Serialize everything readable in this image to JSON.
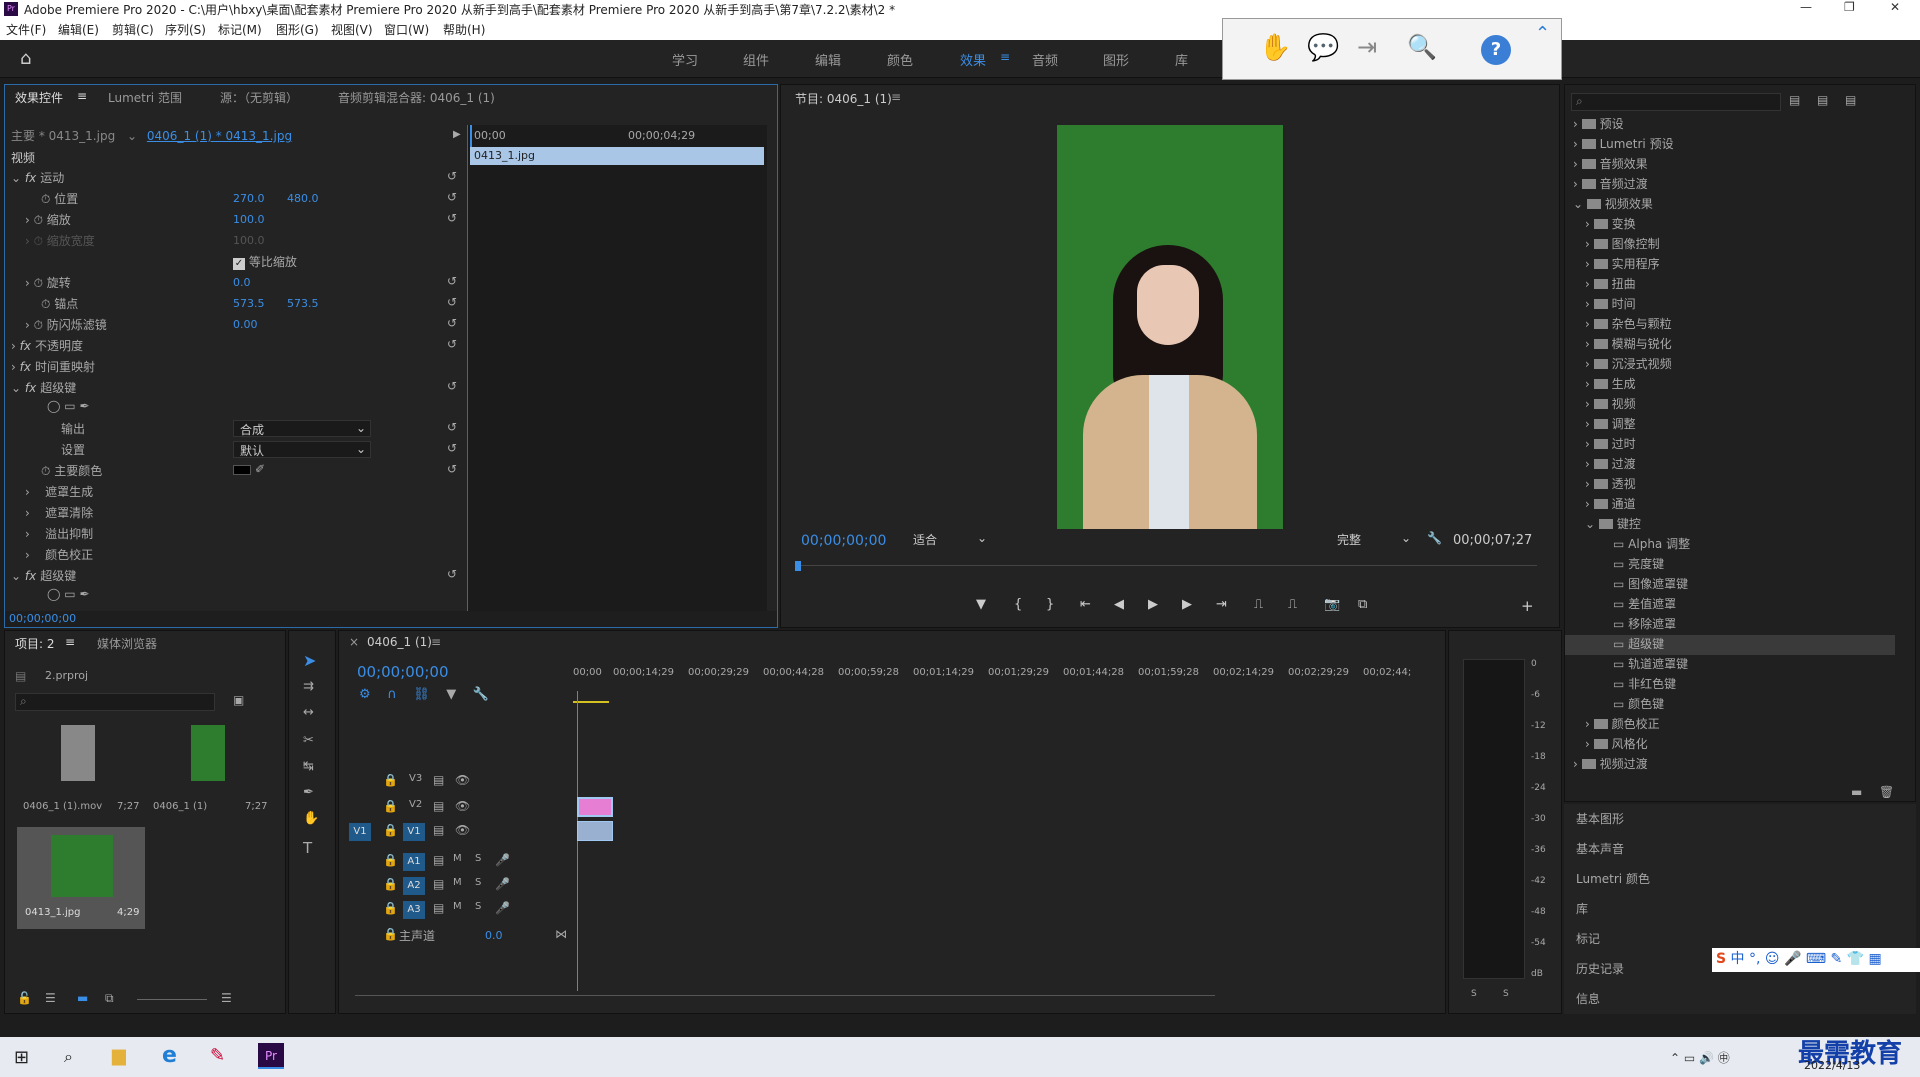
{
  "title": "Adobe Premiere Pro 2020 - C:\\用户\\hbxy\\桌面\\配套素材 Premiere Pro 2020 从新手到高手\\配套素材 Premiere Pro 2020 从新手到高手\\第7章\\7.2.2\\素材\\2 *",
  "menu": [
    "文件(F)",
    "编辑(E)",
    "剪辑(C)",
    "序列(S)",
    "标记(M)",
    "图形(G)",
    "视图(V)",
    "窗口(W)",
    "帮助(H)"
  ],
  "workspaces": [
    "学习",
    "组件",
    "编辑",
    "颜色",
    "效果",
    "音频",
    "图形",
    "库"
  ],
  "effect_controls": {
    "tabs": [
      "效果控件",
      "Lumetri 范围",
      "源：（无剪辑）",
      "音频剪辑混合器: 0406_1 (1)"
    ],
    "source": "主要 * 0413_1.jpg",
    "sequence": "0406_1 (1) * 0413_1.jpg",
    "time_start": "00;00",
    "time_end": "00;00;04;29",
    "clip": "0413_1.jpg",
    "section": "视频",
    "rows": {
      "motion": "运动",
      "position": "位置",
      "pos_x": "270.0",
      "pos_y": "480.0",
      "scale": "缩放",
      "scale_v": "100.0",
      "scale_w": "缩放宽度",
      "scale_w_v": "100.0",
      "uniform": "等比缩放",
      "rotation": "旋转",
      "rot_v": "0.0",
      "anchor": "锚点",
      "anc_x": "573.5",
      "anc_y": "573.5",
      "flicker": "防闪烁滤镜",
      "flicker_v": "0.00",
      "opacity": "不透明度",
      "timeremap": "时间重映射",
      "ultra": "超级键",
      "output": "输出",
      "output_v": "合成",
      "setting": "设置",
      "setting_v": "默认",
      "keycolor": "主要颜色",
      "matte_gen": "遮罩生成",
      "matte_clean": "遮罩清除",
      "spill": "溢出抑制",
      "color_corr": "颜色校正",
      "ultra2": "超级键"
    },
    "timecode": "00;00;00;00"
  },
  "program": {
    "tab": "节目: 0406_1 (1)",
    "timecode": "00;00;00;00",
    "fit": "适合",
    "quality": "完整",
    "duration": "00;00;07;27"
  },
  "effects_tree": [
    "预设",
    "Lumetri 预设",
    "音频效果",
    "音频过渡",
    "视频效果",
    "变换",
    "图像控制",
    "实用程序",
    "扭曲",
    "时间",
    "杂色与颗粒",
    "模糊与锐化",
    "沉浸式视频",
    "生成",
    "视频",
    "调整",
    "过时",
    "过渡",
    "透视",
    "通道",
    "键控",
    "Alpha 调整",
    "亮度键",
    "图像遮罩键",
    "差值遮罩",
    "移除遮罩",
    "超级键",
    "轨道遮罩键",
    "非红色键",
    "颜色键",
    "颜色校正",
    "风格化",
    "视频过渡"
  ],
  "side_panels": [
    "基本图形",
    "基本声音",
    "Lumetri 颜色",
    "库",
    "标记",
    "历史记录",
    "信息"
  ],
  "project": {
    "tabs": [
      "项目: 2",
      "媒体浏览器"
    ],
    "file": "2.prproj",
    "items": [
      {
        "name": "0406_1 (1).mov",
        "dur": "7;27"
      },
      {
        "name": "0406_1 (1)",
        "dur": "7;27"
      },
      {
        "name": "0413_1.jpg",
        "dur": "4;29"
      }
    ]
  },
  "timeline": {
    "tab": "0406_1 (1)",
    "timecode": "00;00;00;00",
    "ruler": [
      "00;00",
      "00;00;14;29",
      "00;00;29;29",
      "00;00;44;28",
      "00;00;59;28",
      "00;01;14;29",
      "00;01;29;29",
      "00;01;44;28",
      "00;01;59;28",
      "00;02;14;29",
      "00;02;29;29",
      "00;02;44;"
    ],
    "tracks": [
      "V3",
      "V2",
      "V1",
      "A1",
      "A2",
      "A3"
    ],
    "master": "主声道",
    "master_v": "0.0"
  },
  "meter": [
    "0",
    "-6",
    "-12",
    "-18",
    "-24",
    "-30",
    "-36",
    "-42",
    "-48",
    "-54",
    "dB"
  ],
  "taskbar": {
    "date": "2022/4/13",
    "brand": "最需教育"
  },
  "colors": {
    "accent": "#3a8ee6",
    "green_bg": "#2e7d2e"
  }
}
